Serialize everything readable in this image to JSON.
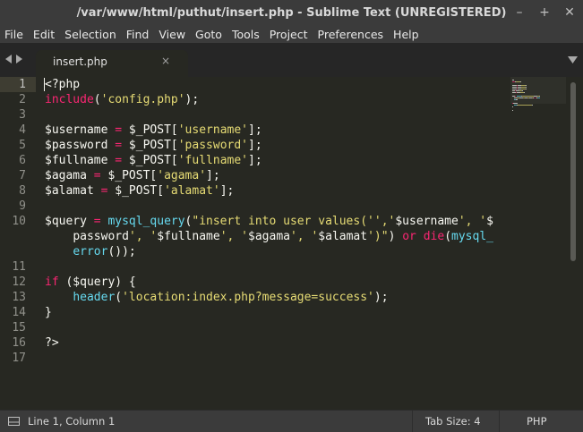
{
  "window": {
    "title": "/var/www/html/puthut/insert.php - Sublime Text (UNREGISTERED)",
    "controls": {
      "minimize": "–",
      "maximize": "+",
      "close": "✕"
    }
  },
  "menu": [
    "File",
    "Edit",
    "Selection",
    "Find",
    "View",
    "Goto",
    "Tools",
    "Project",
    "Preferences",
    "Help"
  ],
  "tabs": [
    {
      "label": "insert.php",
      "active": true,
      "close": "×"
    }
  ],
  "editor": {
    "active_line": 1,
    "lines": [
      {
        "n": "1",
        "tokens": [
          {
            "t": "<?php",
            "c": "p"
          }
        ]
      },
      {
        "n": "2",
        "tokens": [
          {
            "t": "include",
            "c": "k"
          },
          {
            "t": "(",
            "c": "p"
          },
          {
            "t": "'config.php'",
            "c": "s"
          },
          {
            "t": ");",
            "c": "p"
          }
        ]
      },
      {
        "n": "3",
        "tokens": []
      },
      {
        "n": "4",
        "tokens": [
          {
            "t": "$username ",
            "c": "p"
          },
          {
            "t": "=",
            "c": "k"
          },
          {
            "t": " $_POST[",
            "c": "p"
          },
          {
            "t": "'username'",
            "c": "s"
          },
          {
            "t": "];",
            "c": "p"
          }
        ]
      },
      {
        "n": "5",
        "tokens": [
          {
            "t": "$password ",
            "c": "p"
          },
          {
            "t": "=",
            "c": "k"
          },
          {
            "t": " $_POST[",
            "c": "p"
          },
          {
            "t": "'password'",
            "c": "s"
          },
          {
            "t": "];",
            "c": "p"
          }
        ]
      },
      {
        "n": "6",
        "tokens": [
          {
            "t": "$fullname ",
            "c": "p"
          },
          {
            "t": "=",
            "c": "k"
          },
          {
            "t": " $_POST[",
            "c": "p"
          },
          {
            "t": "'fullname'",
            "c": "s"
          },
          {
            "t": "];",
            "c": "p"
          }
        ]
      },
      {
        "n": "7",
        "tokens": [
          {
            "t": "$agama ",
            "c": "p"
          },
          {
            "t": "=",
            "c": "k"
          },
          {
            "t": " $_POST[",
            "c": "p"
          },
          {
            "t": "'agama'",
            "c": "s"
          },
          {
            "t": "];",
            "c": "p"
          }
        ]
      },
      {
        "n": "8",
        "tokens": [
          {
            "t": "$alamat ",
            "c": "p"
          },
          {
            "t": "=",
            "c": "k"
          },
          {
            "t": " $_POST[",
            "c": "p"
          },
          {
            "t": "'alamat'",
            "c": "s"
          },
          {
            "t": "];",
            "c": "p"
          }
        ]
      },
      {
        "n": "9",
        "tokens": []
      },
      {
        "n": "10",
        "tokens": [
          {
            "t": "$query ",
            "c": "p"
          },
          {
            "t": "=",
            "c": "k"
          },
          {
            "t": " ",
            "c": "p"
          },
          {
            "t": "mysql_query",
            "c": "f"
          },
          {
            "t": "(",
            "c": "p"
          },
          {
            "t": "\"insert into user values('','",
            "c": "s"
          },
          {
            "t": "$username",
            "c": "p"
          },
          {
            "t": "', '",
            "c": "s"
          },
          {
            "t": "$",
            "c": "p"
          }
        ]
      },
      {
        "n": "",
        "tokens": [
          {
            "t": "    ",
            "c": "p"
          },
          {
            "t": "password",
            "c": "p"
          },
          {
            "t": "', '",
            "c": "s"
          },
          {
            "t": "$fullname",
            "c": "p"
          },
          {
            "t": "', '",
            "c": "s"
          },
          {
            "t": "$agama",
            "c": "p"
          },
          {
            "t": "', '",
            "c": "s"
          },
          {
            "t": "$alamat",
            "c": "p"
          },
          {
            "t": "')\"",
            "c": "s"
          },
          {
            "t": ") ",
            "c": "p"
          },
          {
            "t": "or",
            "c": "k"
          },
          {
            "t": " ",
            "c": "p"
          },
          {
            "t": "die",
            "c": "k"
          },
          {
            "t": "(",
            "c": "p"
          },
          {
            "t": "mysql_",
            "c": "f"
          }
        ]
      },
      {
        "n": "",
        "tokens": [
          {
            "t": "    ",
            "c": "p"
          },
          {
            "t": "error",
            "c": "f"
          },
          {
            "t": "());",
            "c": "p"
          }
        ]
      },
      {
        "n": "11",
        "tokens": []
      },
      {
        "n": "12",
        "tokens": [
          {
            "t": "if",
            "c": "k"
          },
          {
            "t": " ($query) {",
            "c": "p"
          }
        ]
      },
      {
        "n": "13",
        "tokens": [
          {
            "t": "    ",
            "c": "p"
          },
          {
            "t": "header",
            "c": "f"
          },
          {
            "t": "(",
            "c": "p"
          },
          {
            "t": "'location:index.php?message=success'",
            "c": "s"
          },
          {
            "t": ");",
            "c": "p"
          }
        ]
      },
      {
        "n": "14",
        "tokens": [
          {
            "t": "}",
            "c": "p"
          }
        ]
      },
      {
        "n": "15",
        "tokens": []
      },
      {
        "n": "16",
        "tokens": [
          {
            "t": "?>",
            "c": "p"
          }
        ]
      },
      {
        "n": "17",
        "tokens": []
      }
    ]
  },
  "status": {
    "position": "Line 1, Column 1",
    "tab_size": "Tab Size: 4",
    "syntax": "PHP"
  },
  "colors": {
    "keyword": "#f92672",
    "function": "#66d9ef",
    "string": "#e6db74",
    "plain": "#f8f8f2",
    "background": "#272822"
  }
}
